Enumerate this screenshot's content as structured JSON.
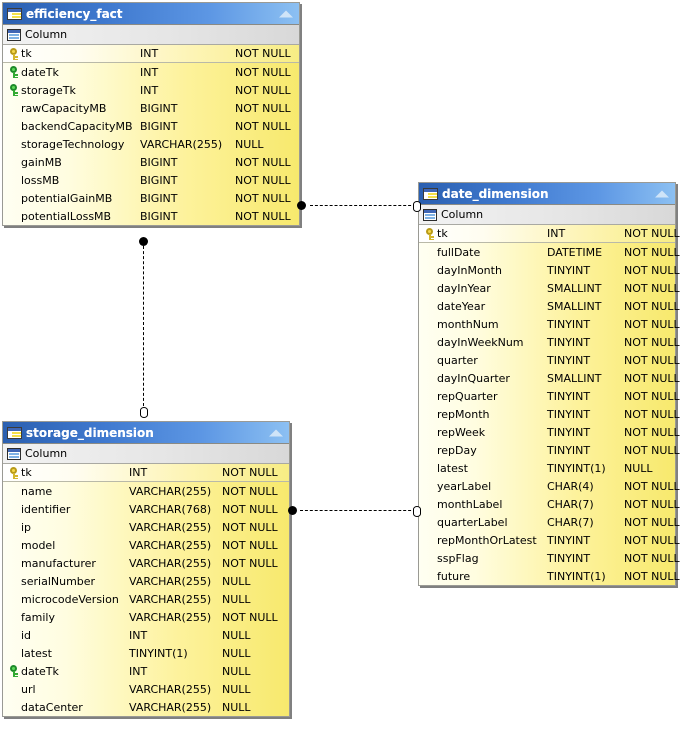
{
  "diagram": {
    "column_section_label": "Column",
    "icons": {
      "table": "table-icon",
      "column": "column-icon",
      "collapse": "collapse-arrow-icon",
      "pk": "gold-key-icon",
      "fk": "green-key-icon"
    }
  },
  "tables": [
    {
      "id": "efficiency_fact",
      "name": "efficiency_fact",
      "columns": [
        {
          "key": "pk",
          "name": "tk",
          "type": "INT",
          "nullable": "NOT NULL"
        },
        {
          "key": "fk",
          "name": "dateTk",
          "type": "INT",
          "nullable": "NOT NULL"
        },
        {
          "key": "fk",
          "name": "storageTk",
          "type": "INT",
          "nullable": "NOT NULL"
        },
        {
          "key": "",
          "name": "rawCapacityMB",
          "type": "BIGINT",
          "nullable": "NOT NULL"
        },
        {
          "key": "",
          "name": "backendCapacityMB",
          "type": "BIGINT",
          "nullable": "NOT NULL"
        },
        {
          "key": "",
          "name": "storageTechnology",
          "type": "VARCHAR(255)",
          "nullable": "NULL"
        },
        {
          "key": "",
          "name": "gainMB",
          "type": "BIGINT",
          "nullable": "NOT NULL"
        },
        {
          "key": "",
          "name": "lossMB",
          "type": "BIGINT",
          "nullable": "NOT NULL"
        },
        {
          "key": "",
          "name": "potentialGainMB",
          "type": "BIGINT",
          "nullable": "NOT NULL"
        },
        {
          "key": "",
          "name": "potentialLossMB",
          "type": "BIGINT",
          "nullable": "NOT NULL"
        }
      ]
    },
    {
      "id": "date_dimension",
      "name": "date_dimension",
      "columns": [
        {
          "key": "pk",
          "name": "tk",
          "type": "INT",
          "nullable": "NOT NULL"
        },
        {
          "key": "",
          "name": "fullDate",
          "type": "DATETIME",
          "nullable": "NOT NULL"
        },
        {
          "key": "",
          "name": "dayInMonth",
          "type": "TINYINT",
          "nullable": "NOT NULL"
        },
        {
          "key": "",
          "name": "dayInYear",
          "type": "SMALLINT",
          "nullable": "NOT NULL"
        },
        {
          "key": "",
          "name": "dateYear",
          "type": "SMALLINT",
          "nullable": "NOT NULL"
        },
        {
          "key": "",
          "name": "monthNum",
          "type": "TINYINT",
          "nullable": "NOT NULL"
        },
        {
          "key": "",
          "name": "dayInWeekNum",
          "type": "TINYINT",
          "nullable": "NOT NULL"
        },
        {
          "key": "",
          "name": "quarter",
          "type": "TINYINT",
          "nullable": "NOT NULL"
        },
        {
          "key": "",
          "name": "dayInQuarter",
          "type": "SMALLINT",
          "nullable": "NOT NULL"
        },
        {
          "key": "",
          "name": "repQuarter",
          "type": "TINYINT",
          "nullable": "NOT NULL"
        },
        {
          "key": "",
          "name": "repMonth",
          "type": "TINYINT",
          "nullable": "NOT NULL"
        },
        {
          "key": "",
          "name": "repWeek",
          "type": "TINYINT",
          "nullable": "NOT NULL"
        },
        {
          "key": "",
          "name": "repDay",
          "type": "TINYINT",
          "nullable": "NOT NULL"
        },
        {
          "key": "",
          "name": "latest",
          "type": "TINYINT(1)",
          "nullable": "NULL"
        },
        {
          "key": "",
          "name": "yearLabel",
          "type": "CHAR(4)",
          "nullable": "NOT NULL"
        },
        {
          "key": "",
          "name": "monthLabel",
          "type": "CHAR(7)",
          "nullable": "NOT NULL"
        },
        {
          "key": "",
          "name": "quarterLabel",
          "type": "CHAR(7)",
          "nullable": "NOT NULL"
        },
        {
          "key": "",
          "name": "repMonthOrLatest",
          "type": "TINYINT",
          "nullable": "NOT NULL"
        },
        {
          "key": "",
          "name": "sspFlag",
          "type": "TINYINT",
          "nullable": "NOT NULL"
        },
        {
          "key": "",
          "name": "future",
          "type": "TINYINT(1)",
          "nullable": "NOT NULL"
        }
      ]
    },
    {
      "id": "storage_dimension",
      "name": "storage_dimension",
      "columns": [
        {
          "key": "pk",
          "name": "tk",
          "type": "INT",
          "nullable": "NOT NULL"
        },
        {
          "key": "",
          "name": "name",
          "type": "VARCHAR(255)",
          "nullable": "NOT NULL"
        },
        {
          "key": "",
          "name": "identifier",
          "type": "VARCHAR(768)",
          "nullable": "NOT NULL"
        },
        {
          "key": "",
          "name": "ip",
          "type": "VARCHAR(255)",
          "nullable": "NOT NULL"
        },
        {
          "key": "",
          "name": "model",
          "type": "VARCHAR(255)",
          "nullable": "NOT NULL"
        },
        {
          "key": "",
          "name": "manufacturer",
          "type": "VARCHAR(255)",
          "nullable": "NOT NULL"
        },
        {
          "key": "",
          "name": "serialNumber",
          "type": "VARCHAR(255)",
          "nullable": "NULL"
        },
        {
          "key": "",
          "name": "microcodeVersion",
          "type": "VARCHAR(255)",
          "nullable": "NULL"
        },
        {
          "key": "",
          "name": "family",
          "type": "VARCHAR(255)",
          "nullable": "NOT NULL"
        },
        {
          "key": "",
          "name": "id",
          "type": "INT",
          "nullable": "NULL"
        },
        {
          "key": "",
          "name": "latest",
          "type": "TINYINT(1)",
          "nullable": "NULL"
        },
        {
          "key": "fk",
          "name": "dateTk",
          "type": "INT",
          "nullable": "NULL"
        },
        {
          "key": "",
          "name": "url",
          "type": "VARCHAR(255)",
          "nullable": "NULL"
        },
        {
          "key": "",
          "name": "dataCenter",
          "type": "VARCHAR(255)",
          "nullable": "NULL"
        }
      ]
    }
  ],
  "relationships": [
    {
      "id": "rel-efficiency-date",
      "from": "efficiency_fact",
      "to": "date_dimension",
      "from_marker": "filled-circle",
      "to_marker": "open-diamond"
    },
    {
      "id": "rel-efficiency-storage",
      "from": "efficiency_fact",
      "to": "storage_dimension",
      "from_marker": "filled-circle",
      "to_marker": "open-diamond"
    },
    {
      "id": "rel-storage-date",
      "from": "storage_dimension",
      "to": "date_dimension",
      "from_marker": "filled-circle",
      "to_marker": "open-diamond"
    }
  ]
}
